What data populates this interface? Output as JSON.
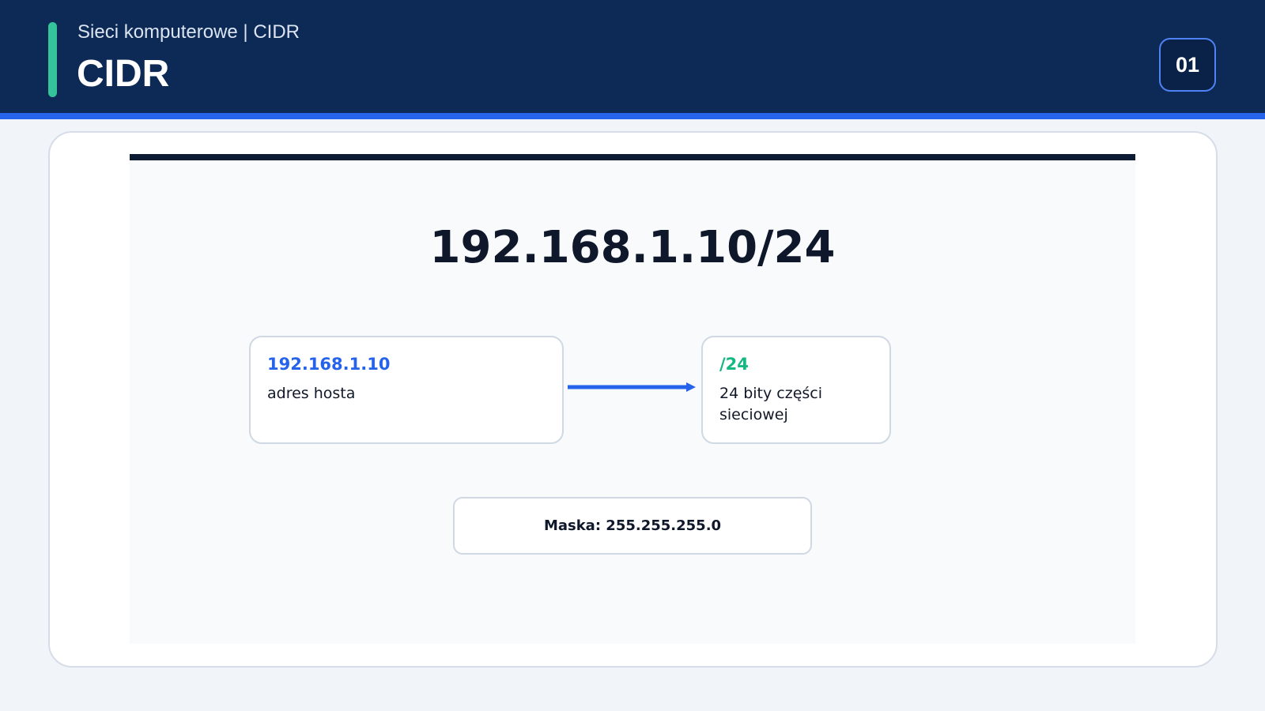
{
  "header": {
    "subtitle": "Sieci komputerowe | CIDR",
    "title": "CIDR",
    "page_number": "01"
  },
  "diagram": {
    "heading": "192.168.1.10/24",
    "host_box": {
      "title": "192.168.1.10",
      "description": "adres hosta"
    },
    "prefix_box": {
      "title": "/24",
      "description": "24 bity części sieciowej"
    },
    "mask": "Maska: 255.255.255.0"
  },
  "colors": {
    "header_bg": "#0c2a55",
    "accent_green": "#34c39a",
    "accent_blue": "#2563eb",
    "prefix_green": "#14b883",
    "dark_text": "#0f172a"
  }
}
